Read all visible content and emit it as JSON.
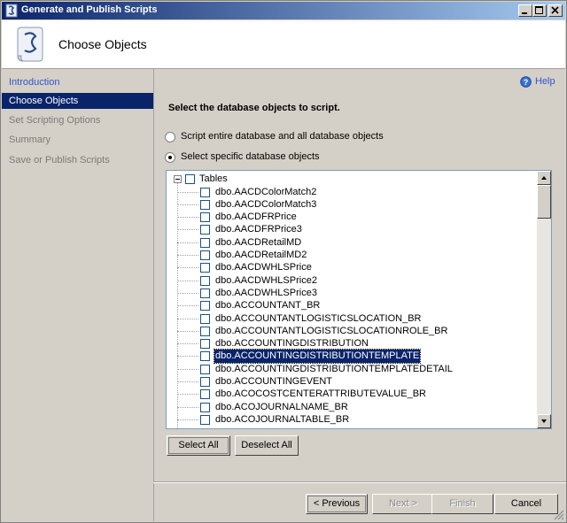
{
  "window": {
    "title": "Generate and Publish Scripts",
    "controls": [
      "minimize",
      "maximize",
      "close"
    ]
  },
  "header": {
    "page_title": "Choose Objects",
    "icon": "script-scroll-icon"
  },
  "sidebar": {
    "items": [
      {
        "label": "Introduction",
        "state": "link"
      },
      {
        "label": "Choose Objects",
        "state": "active"
      },
      {
        "label": "Set Scripting Options",
        "state": "disabled"
      },
      {
        "label": "Summary",
        "state": "disabled"
      },
      {
        "label": "Save or Publish Scripts",
        "state": "disabled"
      }
    ]
  },
  "help": {
    "label": "Help",
    "icon": "help-icon"
  },
  "main": {
    "instruction": "Select the database objects to script.",
    "radios": [
      {
        "label": "Script entire database and all database objects",
        "checked": false
      },
      {
        "label": "Select specific database objects",
        "checked": true
      }
    ],
    "tree": {
      "root_label": "Tables",
      "root_checked": false,
      "items": [
        {
          "label": "dbo.AACDColorMatch2",
          "selected": false
        },
        {
          "label": "dbo.AACDColorMatch3",
          "selected": false
        },
        {
          "label": "dbo.AACDFRPrice",
          "selected": false
        },
        {
          "label": "dbo.AACDFRPrice3",
          "selected": false
        },
        {
          "label": "dbo.AACDRetailMD",
          "selected": false
        },
        {
          "label": "dbo.AACDRetailMD2",
          "selected": false
        },
        {
          "label": "dbo.AACDWHLSPrice",
          "selected": false
        },
        {
          "label": "dbo.AACDWHLSPrice2",
          "selected": false
        },
        {
          "label": "dbo.AACDWHLSPrice3",
          "selected": false
        },
        {
          "label": "dbo.ACCOUNTANT_BR",
          "selected": false
        },
        {
          "label": "dbo.ACCOUNTANTLOGISTICSLOCATION_BR",
          "selected": false
        },
        {
          "label": "dbo.ACCOUNTANTLOGISTICSLOCATIONROLE_BR",
          "selected": false
        },
        {
          "label": "dbo.ACCOUNTINGDISTRIBUTION",
          "selected": false
        },
        {
          "label": "dbo.ACCOUNTINGDISTRIBUTIONTEMPLATE",
          "selected": true
        },
        {
          "label": "dbo.ACCOUNTINGDISTRIBUTIONTEMPLATEDETAIL",
          "selected": false
        },
        {
          "label": "dbo.ACCOUNTINGEVENT",
          "selected": false
        },
        {
          "label": "dbo.ACOCOSTCENTERATTRIBUTEVALUE_BR",
          "selected": false
        },
        {
          "label": "dbo.ACOJOURNALNAME_BR",
          "selected": false
        },
        {
          "label": "dbo.ACOJOURNALTABLE_BR",
          "selected": false
        }
      ]
    },
    "select_all": "Select All",
    "deselect_all": "Deselect All"
  },
  "footer": {
    "previous": "< Previous",
    "next": "Next >",
    "finish": "Finish",
    "cancel": "Cancel"
  },
  "colors": {
    "title_bar": "#0a246a",
    "selection": "#0a246a",
    "link": "#3355cc",
    "face": "#d4d0c8"
  }
}
